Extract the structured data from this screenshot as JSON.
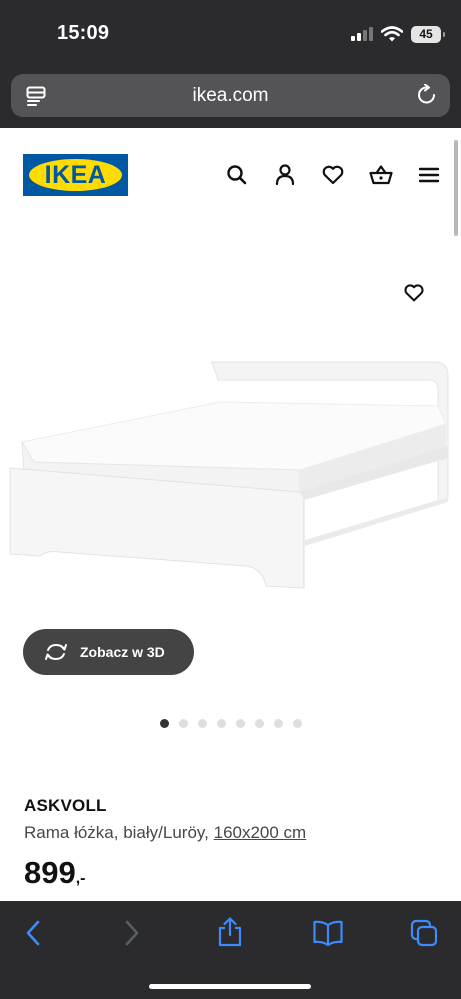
{
  "status": {
    "time": "15:09",
    "battery": "45"
  },
  "browser": {
    "url": "ikea.com"
  },
  "header": {
    "logo_text": "IKEA",
    "brand_colors": {
      "blue": "#0058a3",
      "yellow": "#ffdb00"
    }
  },
  "gallery": {
    "view_3d_label": "Zobacz w 3D",
    "dot_count": 8,
    "active_dot": 0
  },
  "product": {
    "name": "ASKVOLL",
    "description": "Rama łóżka, biały/Luröy,",
    "size": "160x200 cm",
    "price": "899",
    "price_suffix": ",-"
  }
}
